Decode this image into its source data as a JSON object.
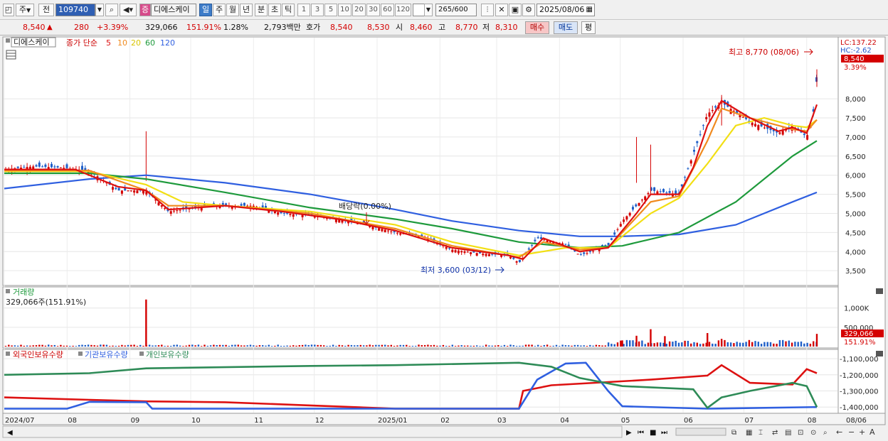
{
  "toolbar": {
    "period_main": "주",
    "jeon": "전",
    "code": "109740",
    "stock_name": "디에스케이",
    "stock_badge": "증",
    "period_buttons": [
      "일",
      "주",
      "월",
      "년",
      "분",
      "초",
      "틱"
    ],
    "selected_period": "일",
    "interval_buttons": [
      "1",
      "3",
      "5",
      "10",
      "20",
      "30",
      "60",
      "120"
    ],
    "count_value": "265",
    "count_total": "/600",
    "date": "2025/08/06"
  },
  "quote": {
    "price": "8,540",
    "arrow": "▲",
    "change": "280",
    "change_pct": "+3.39%",
    "volume": "329,066",
    "volume_ratio": "151.91%",
    "turnover": "1.28%",
    "amount": "2,793백만",
    "hoga_label": "호가",
    "ask": "8,540",
    "bid": "8,530",
    "open_label": "시",
    "open": "8,460",
    "high_label": "고",
    "high": "8,770",
    "low_label": "저",
    "low": "8,310",
    "buy_btn": "매수",
    "sell_btn": "매도",
    "eval_btn": "평"
  },
  "price_panel": {
    "name_label": "디에스케이",
    "ma_label": "종가 단순",
    "ma_periods": [
      "5",
      "10",
      "20",
      "60",
      "120"
    ],
    "lc_label": "LC:137.22",
    "hc_label": "HC:-2.62",
    "current_label": "8,540",
    "pct_label": "3.39%",
    "high_annotation": "최고 8,770 (08/06)",
    "low_annotation": "최저 3,600 (03/12)",
    "dividend_annotation": "배당락(0.00%)"
  },
  "volume_panel": {
    "title": "거래량",
    "summary": "329,066주(151.91%)",
    "current_label": "329,066",
    "ratio_label": "151.91%"
  },
  "holding_panel": {
    "legend": [
      "외국인보유수량",
      "기관보유수량",
      "개인보유수량"
    ]
  },
  "x_axis": {
    "labels": [
      "2024/07",
      "08",
      "09",
      "10",
      "11",
      "12",
      "2025/01",
      "02",
      "03",
      "04",
      "05",
      "06",
      "07",
      "08",
      "08/06"
    ]
  },
  "colors": {
    "candle_up": "#d40000",
    "candle_down": "#1f5fc8",
    "ma5": "#dd1111",
    "ma10": "#f08a1e",
    "ma20": "#f2df14",
    "ma60": "#1e9a3c",
    "ma120": "#2f5fe0",
    "foreign": "#dd1111",
    "institution": "#2f5fe0",
    "individual": "#2e8b57"
  },
  "chart_data": [
    {
      "type": "candlestick",
      "title": "디에스케이",
      "x_range": [
        "2024/07",
        "2025/08/06"
      ],
      "yticks": [
        3500,
        4000,
        4500,
        5000,
        5500,
        6000,
        6500,
        7000,
        7500,
        8000
      ],
      "ytick_labels": [
        "3,500",
        "4,000",
        "4,500",
        "5,000",
        "5,500",
        "6,000",
        "6,500",
        "7,000",
        "7,500",
        "8,000"
      ],
      "ylim": [
        3150,
        8950
      ],
      "series": [
        {
          "name": "close",
          "points": [
            [
              "2024-07-01",
              6150
            ],
            [
              "2024-07-15",
              6230
            ],
            [
              "2024-07-29",
              6200
            ],
            [
              "2024-08-12",
              6120
            ],
            [
              "2024-08-26",
              5600
            ],
            [
              "2024-09-09",
              5600
            ],
            [
              "2024-09-20",
              5050
            ],
            [
              "2024-10-04",
              5150
            ],
            [
              "2024-10-18",
              5200
            ],
            [
              "2024-11-01",
              5200
            ],
            [
              "2024-11-15",
              5000
            ],
            [
              "2024-11-29",
              4950
            ],
            [
              "2024-12-13",
              4850
            ],
            [
              "2024-12-27",
              4700
            ],
            [
              "2025-01-10",
              4500
            ],
            [
              "2025-01-24",
              4400
            ],
            [
              "2025-02-07",
              4050
            ],
            [
              "2025-02-21",
              3950
            ],
            [
              "2025-03-07",
              3900
            ],
            [
              "2025-03-12",
              3700
            ],
            [
              "2025-03-21",
              4350
            ],
            [
              "2025-04-04",
              4200
            ],
            [
              "2025-04-11",
              3900
            ],
            [
              "2025-04-25",
              4150
            ],
            [
              "2025-05-02",
              4800
            ],
            [
              "2025-05-09",
              5200
            ],
            [
              "2025-05-16",
              5600
            ],
            [
              "2025-05-30",
              5500
            ],
            [
              "2025-06-13",
              7600
            ],
            [
              "2025-06-20",
              7900
            ],
            [
              "2025-07-04",
              7400
            ],
            [
              "2025-07-18",
              7100
            ],
            [
              "2025-07-25",
              7300
            ],
            [
              "2025-08-01",
              7000
            ],
            [
              "2025-08-04",
              7500
            ],
            [
              "2025-08-06",
              8540
            ]
          ]
        }
      ],
      "ma_lines": [
        {
          "name": "5",
          "points": [
            [
              "2024-07-01",
              6150
            ],
            [
              "2024-08-05",
              6150
            ],
            [
              "2024-08-26",
              5700
            ],
            [
              "2024-09-09",
              5600
            ],
            [
              "2024-09-20",
              5100
            ],
            [
              "2024-10-04",
              5150
            ],
            [
              "2024-10-18",
              5200
            ],
            [
              "2024-11-15",
              5050
            ],
            [
              "2024-12-13",
              4850
            ],
            [
              "2025-01-10",
              4550
            ],
            [
              "2025-02-07",
              4100
            ],
            [
              "2025-03-07",
              3900
            ],
            [
              "2025-03-14",
              3800
            ],
            [
              "2025-03-24",
              4350
            ],
            [
              "2025-04-11",
              4000
            ],
            [
              "2025-04-25",
              4100
            ],
            [
              "2025-05-09",
              5000
            ],
            [
              "2025-05-16",
              5500
            ],
            [
              "2025-05-30",
              5500
            ],
            [
              "2025-06-06",
              6200
            ],
            [
              "2025-06-13",
              7300
            ],
            [
              "2025-06-20",
              7950
            ],
            [
              "2025-07-04",
              7500
            ],
            [
              "2025-07-18",
              7150
            ],
            [
              "2025-07-25",
              7250
            ],
            [
              "2025-08-01",
              7100
            ],
            [
              "2025-08-06",
              7850
            ]
          ]
        },
        {
          "name": "10",
          "points": [
            [
              "2024-07-01",
              6120
            ],
            [
              "2024-08-12",
              6120
            ],
            [
              "2024-09-09",
              5600
            ],
            [
              "2024-09-20",
              5200
            ],
            [
              "2024-10-18",
              5200
            ],
            [
              "2024-11-29",
              5000
            ],
            [
              "2025-01-10",
              4600
            ],
            [
              "2025-02-07",
              4150
            ],
            [
              "2025-03-12",
              3850
            ],
            [
              "2025-03-24",
              4250
            ],
            [
              "2025-04-11",
              4050
            ],
            [
              "2025-04-25",
              4100
            ],
            [
              "2025-05-16",
              5300
            ],
            [
              "2025-05-30",
              5450
            ],
            [
              "2025-06-13",
              6900
            ],
            [
              "2025-06-20",
              7750
            ],
            [
              "2025-07-04",
              7500
            ],
            [
              "2025-07-25",
              7200
            ],
            [
              "2025-08-01",
              7150
            ],
            [
              "2025-08-06",
              7450
            ]
          ]
        },
        {
          "name": "20",
          "points": [
            [
              "2024-07-01",
              6100
            ],
            [
              "2024-08-12",
              6100
            ],
            [
              "2024-09-09",
              5750
            ],
            [
              "2024-09-27",
              5300
            ],
            [
              "2024-10-18",
              5200
            ],
            [
              "2024-11-29",
              5050
            ],
            [
              "2025-01-10",
              4700
            ],
            [
              "2025-02-07",
              4250
            ],
            [
              "2025-03-12",
              3900
            ],
            [
              "2025-04-04",
              4100
            ],
            [
              "2025-04-25",
              4100
            ],
            [
              "2025-05-16",
              5000
            ],
            [
              "2025-05-30",
              5400
            ],
            [
              "2025-06-13",
              6300
            ],
            [
              "2025-06-27",
              7300
            ],
            [
              "2025-07-11",
              7500
            ],
            [
              "2025-07-25",
              7300
            ],
            [
              "2025-08-01",
              7250
            ],
            [
              "2025-08-06",
              7450
            ]
          ]
        },
        {
          "name": "60",
          "points": [
            [
              "2024-07-01",
              6050
            ],
            [
              "2024-08-12",
              6050
            ],
            [
              "2024-09-09",
              5900
            ],
            [
              "2024-10-18",
              5550
            ],
            [
              "2024-11-29",
              5150
            ],
            [
              "2025-01-10",
              4850
            ],
            [
              "2025-02-07",
              4600
            ],
            [
              "2025-03-12",
              4250
            ],
            [
              "2025-04-11",
              4100
            ],
            [
              "2025-05-02",
              4150
            ],
            [
              "2025-05-30",
              4500
            ],
            [
              "2025-06-27",
              5300
            ],
            [
              "2025-07-25",
              6500
            ],
            [
              "2025-08-06",
              6900
            ]
          ]
        },
        {
          "name": "120",
          "points": [
            [
              "2024-07-01",
              5650
            ],
            [
              "2024-08-12",
              5900
            ],
            [
              "2024-09-09",
              6000
            ],
            [
              "2024-10-18",
              5800
            ],
            [
              "2024-11-29",
              5500
            ],
            [
              "2025-01-10",
              5100
            ],
            [
              "2025-02-07",
              4800
            ],
            [
              "2025-03-12",
              4550
            ],
            [
              "2025-04-11",
              4400
            ],
            [
              "2025-05-02",
              4400
            ],
            [
              "2025-05-30",
              4450
            ],
            [
              "2025-06-27",
              4700
            ],
            [
              "2025-07-25",
              5300
            ],
            [
              "2025-08-06",
              5550
            ]
          ]
        }
      ]
    },
    {
      "type": "bar",
      "title": "거래량",
      "yticks": [
        500000,
        1000000
      ],
      "ytick_labels": [
        "500,000",
        "1,000K"
      ],
      "ylim": [
        0,
        1400000
      ],
      "spikes": [
        [
          "2024-09-09",
          1220000
        ],
        [
          "2025-05-02",
          160000
        ],
        [
          "2025-05-09",
          280000
        ],
        [
          "2025-05-16",
          450000
        ],
        [
          "2025-05-23",
          270000
        ],
        [
          "2025-06-13",
          350000
        ],
        [
          "2025-06-20",
          200000
        ],
        [
          "2025-08-06",
          329066
        ]
      ]
    },
    {
      "type": "line",
      "title": "보유수량",
      "yticks": [
        -1100000,
        -1200000,
        -1300000,
        -1400000
      ],
      "ytick_labels": [
        "-1,100,000",
        "-1,200,000",
        "-1,300,000",
        "-1,400,000"
      ],
      "ylim": [
        -1430000,
        -1060000
      ],
      "series": [
        {
          "name": "외국인보유수량",
          "points": [
            [
              "2024-07-01",
              -1340000
            ],
            [
              "2024-08-12",
              -1355000
            ],
            [
              "2024-09-09",
              -1365000
            ],
            [
              "2024-10-18",
              -1370000
            ],
            [
              "2024-11-29",
              -1390000
            ],
            [
              "2025-01-10",
              -1410000
            ],
            [
              "2025-03-12",
              -1410000
            ],
            [
              "2025-03-14",
              -1300000
            ],
            [
              "2025-03-28",
              -1265000
            ],
            [
              "2025-04-25",
              -1245000
            ],
            [
              "2025-05-16",
              -1230000
            ],
            [
              "2025-06-13",
              -1205000
            ],
            [
              "2025-06-20",
              -1140000
            ],
            [
              "2025-07-04",
              -1250000
            ],
            [
              "2025-07-25",
              -1260000
            ],
            [
              "2025-08-01",
              -1165000
            ],
            [
              "2025-08-06",
              -1190000
            ]
          ]
        },
        {
          "name": "기관보유수량",
          "points": [
            [
              "2024-07-01",
              -1410000
            ],
            [
              "2024-08-01",
              -1410000
            ],
            [
              "2024-08-12",
              -1368000
            ],
            [
              "2024-09-09",
              -1370000
            ],
            [
              "2024-09-12",
              -1410000
            ],
            [
              "2025-03-12",
              -1410000
            ],
            [
              "2025-03-21",
              -1230000
            ],
            [
              "2025-04-04",
              -1130000
            ],
            [
              "2025-04-14",
              -1125000
            ],
            [
              "2025-04-25",
              -1300000
            ],
            [
              "2025-05-02",
              -1395000
            ],
            [
              "2025-06-13",
              -1410000
            ],
            [
              "2025-08-06",
              -1400000
            ]
          ]
        },
        {
          "name": "개인보유수량",
          "points": [
            [
              "2024-07-01",
              -1200000
            ],
            [
              "2024-08-12",
              -1190000
            ],
            [
              "2024-09-09",
              -1160000
            ],
            [
              "2024-11-29",
              -1145000
            ],
            [
              "2025-01-10",
              -1140000
            ],
            [
              "2025-03-12",
              -1125000
            ],
            [
              "2025-03-28",
              -1150000
            ],
            [
              "2025-04-11",
              -1220000
            ],
            [
              "2025-05-02",
              -1270000
            ],
            [
              "2025-06-06",
              -1290000
            ],
            [
              "2025-06-13",
              -1405000
            ],
            [
              "2025-06-20",
              -1340000
            ],
            [
              "2025-07-04",
              -1300000
            ],
            [
              "2025-07-25",
              -1250000
            ],
            [
              "2025-08-01",
              -1270000
            ],
            [
              "2025-08-06",
              -1400000
            ]
          ]
        }
      ]
    }
  ]
}
